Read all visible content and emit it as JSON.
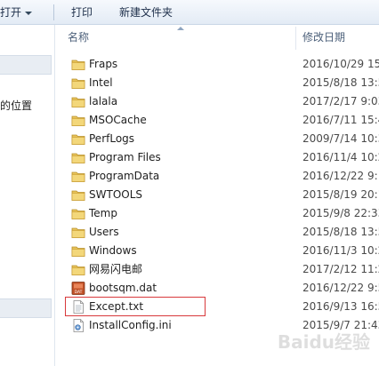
{
  "toolbar": {
    "open_label": "打开",
    "print_label": "打印",
    "new_folder_label": "新建文件夹"
  },
  "sidebar": {
    "partial_label": "的位置"
  },
  "columns": {
    "name": "名称",
    "date_modified": "修改日期"
  },
  "files": [
    {
      "name": "Fraps",
      "date": "2016/10/29 15",
      "type": "folder"
    },
    {
      "name": "Intel",
      "date": "2015/8/18 13:5",
      "type": "folder"
    },
    {
      "name": "lalala",
      "date": "2017/2/17 9:03",
      "type": "folder"
    },
    {
      "name": "MSOCache",
      "date": "2016/7/11 15:4",
      "type": "folder"
    },
    {
      "name": "PerfLogs",
      "date": "2009/7/14 10:3",
      "type": "folder"
    },
    {
      "name": "Program Files",
      "date": "2016/11/4 10:2",
      "type": "folder"
    },
    {
      "name": "ProgramData",
      "date": "2016/12/22 9:",
      "type": "folder"
    },
    {
      "name": "SWTOOLS",
      "date": "2015/8/19 20:1",
      "type": "folder"
    },
    {
      "name": "Temp",
      "date": "2015/9/8 22:33",
      "type": "folder"
    },
    {
      "name": "Users",
      "date": "2015/8/18 13:5",
      "type": "folder"
    },
    {
      "name": "Windows",
      "date": "2016/11/3 10:2",
      "type": "folder"
    },
    {
      "name": "网易闪电邮",
      "date": "2017/2/12 11:2",
      "type": "folder"
    },
    {
      "name": "bootsqm.dat",
      "date": "2016/12/22 9:5",
      "type": "dat"
    },
    {
      "name": "Except.txt",
      "date": "2016/9/13 16:5",
      "type": "txt"
    },
    {
      "name": "InstallConfig.ini",
      "date": "2015/9/7 21:43",
      "type": "ini"
    }
  ],
  "icons": {
    "folder": "folder-icon",
    "dat": "dat-file-icon",
    "txt": "text-file-icon",
    "ini": "config-file-icon"
  },
  "colors": {
    "highlight": "#d8393b",
    "folder": "#e8c35a"
  },
  "watermark": "Baidu经验"
}
